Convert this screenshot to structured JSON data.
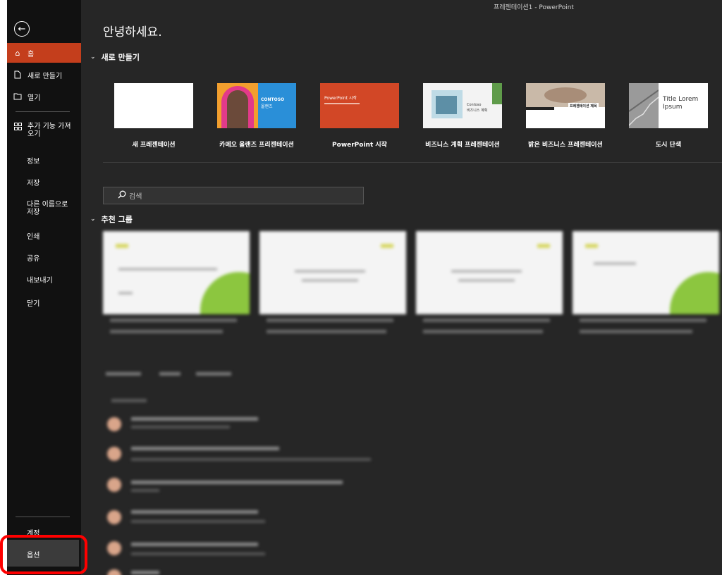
{
  "window": {
    "title": "프레젠테이션1  -  PowerPoint"
  },
  "sidebar": {
    "back_icon": "back-arrow-icon",
    "items": [
      {
        "label": "홈",
        "icon": "home-icon",
        "active": true
      },
      {
        "label": "새로 만들기",
        "icon": "new-file-icon"
      },
      {
        "label": "열기",
        "icon": "open-folder-icon"
      },
      {
        "label": "추가 기능 가져\n오기",
        "icon": "addins-icon"
      },
      {
        "label": "정보"
      },
      {
        "label": "저장"
      },
      {
        "label": "다른 이름으로\n저장"
      },
      {
        "label": "인쇄"
      },
      {
        "label": "공유"
      },
      {
        "label": "내보내기"
      },
      {
        "label": "닫기"
      }
    ],
    "account_label": "계정",
    "options_label": "옵션",
    "accent_color": "#c43e1c",
    "highlight_color": "#ff0000"
  },
  "main": {
    "greeting": "안녕하세요.",
    "new_section": {
      "title": "새로 만들기"
    },
    "templates": [
      {
        "label": "새 프레젠테이션"
      },
      {
        "label": "카메오 올랜즈 프리젠테이션",
        "thumb_title": "CONTOSO",
        "thumb_sub": "올랜즈"
      },
      {
        "label": "PowerPoint 시작",
        "thumb_title": "PowerPoint 시작"
      },
      {
        "label": "비즈니스 계획 프레젠테이션",
        "thumb_title": "Contoso",
        "thumb_sub": "비즈니스 계획"
      },
      {
        "label": "밝은 비즈니스 프레젠테이션",
        "thumb_title": "프레젠테이션 제목"
      },
      {
        "label": "도시 단색",
        "thumb_title": "Title Lorem",
        "thumb_sub": "Ipsum"
      }
    ],
    "search": {
      "placeholder": "검색",
      "icon": "search-icon"
    },
    "recommended_section": {
      "title": "추천 그룹"
    }
  }
}
